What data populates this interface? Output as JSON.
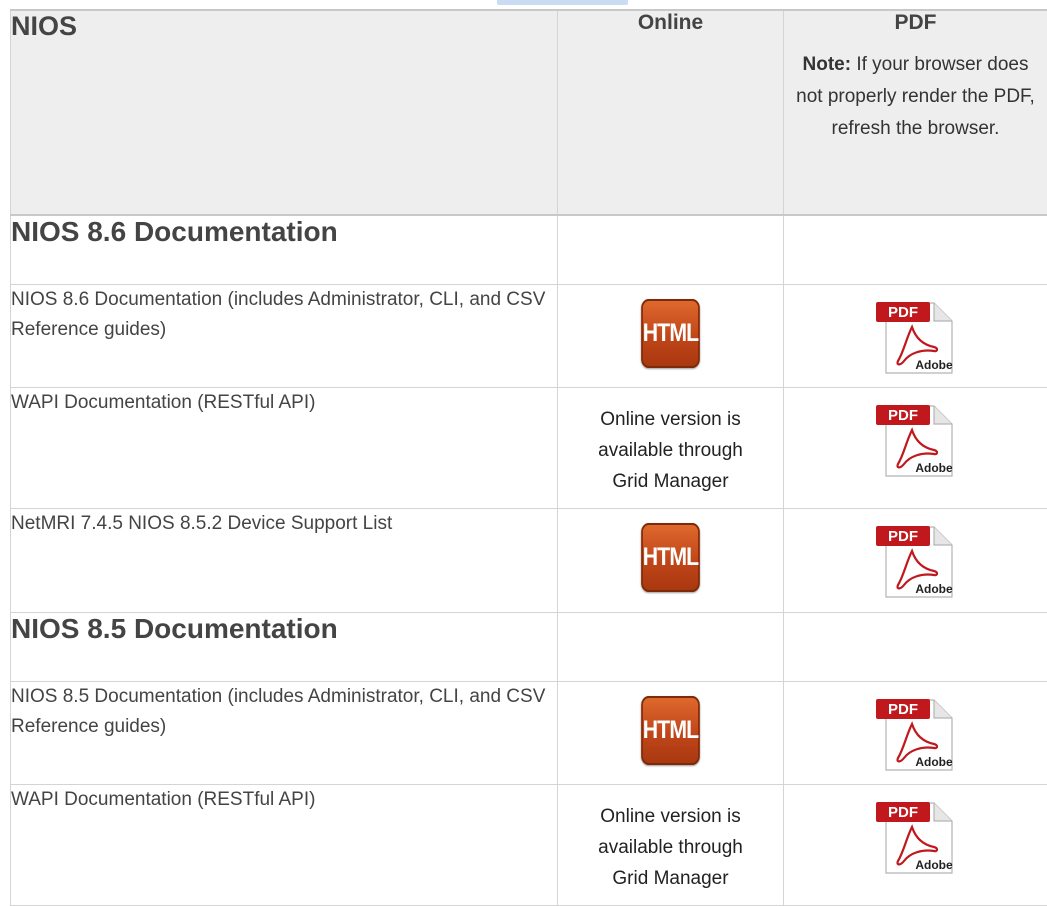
{
  "table": {
    "headers": {
      "title": "NIOS",
      "online": "Online",
      "pdf": "PDF",
      "note_label": "Note:",
      "note_text": " If your browser does not properly render the PDF, refresh the browser."
    },
    "sections": [
      {
        "title": "NIOS 8.6 Documentation",
        "rows": [
          {
            "desc": "NIOS 8.6 Documentation (includes Administrator, CLI, and CSV Reference guides)",
            "online_icon": "HTML",
            "pdf_icon": "PDF"
          },
          {
            "desc": "WAPI Documentation (RESTful API)",
            "online_text": "Online version is available through Grid Manager",
            "pdf_icon": "PDF"
          },
          {
            "desc": "NetMRI 7.4.5 NIOS 8.5.2 Device Support List",
            "online_icon": "HTML",
            "pdf_icon": "PDF"
          }
        ]
      },
      {
        "title": "NIOS 8.5 Documentation",
        "rows": [
          {
            "desc": "NIOS 8.5 Documentation (includes Administrator, CLI, and CSV Reference guides)",
            "online_icon": "HTML",
            "pdf_icon": "PDF"
          },
          {
            "desc": "WAPI Documentation (RESTful API)",
            "online_text": "Online version is available through Grid Manager",
            "pdf_icon": "PDF"
          }
        ]
      }
    ]
  },
  "icons": {
    "html_label": "HTML",
    "pdf_label": "PDF",
    "adobe_label": "Adobe"
  },
  "colors": {
    "html_icon": "#c0461a",
    "pdf_banner": "#c0181d",
    "header_bg": "#eeeeee",
    "border": "#d4d4d4"
  }
}
